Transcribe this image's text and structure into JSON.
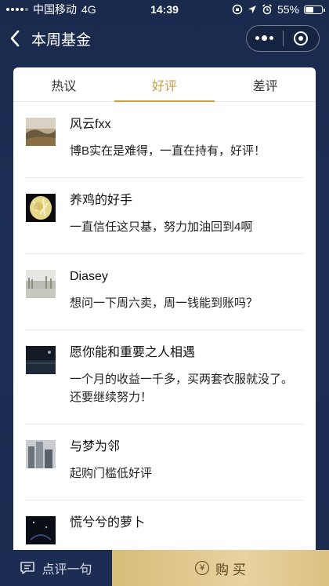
{
  "status_bar": {
    "carrier": "中国移动",
    "network": "4G",
    "time": "14:39",
    "battery": "55%",
    "battery_level": 0.55
  },
  "nav": {
    "title": "本周基金"
  },
  "tabs": [
    {
      "label": "热议",
      "active": false
    },
    {
      "label": "好评",
      "active": true
    },
    {
      "label": "差评",
      "active": false
    }
  ],
  "reviews": [
    {
      "name": "风云fxx",
      "comment": "博B实在是难得，一直在持有，好评！"
    },
    {
      "name": "养鸡的好手",
      "comment": "一直信任这只基，努力加油回到4啊"
    },
    {
      "name": "Diasey",
      "comment": "想问一下周六卖，周一钱能到账吗？"
    },
    {
      "name": "愿你能和重要之人相遇",
      "comment": "一个月的收益一千多，买两套衣服就没了。还要继续努力！"
    },
    {
      "name": "与梦为邻",
      "comment": "起购门槛低好评"
    },
    {
      "name": "慌兮兮的萝卜",
      "comment": ""
    }
  ],
  "bottom": {
    "comment_label": "点评一句",
    "buy_label": "购 买",
    "yen_symbol": "¥"
  }
}
